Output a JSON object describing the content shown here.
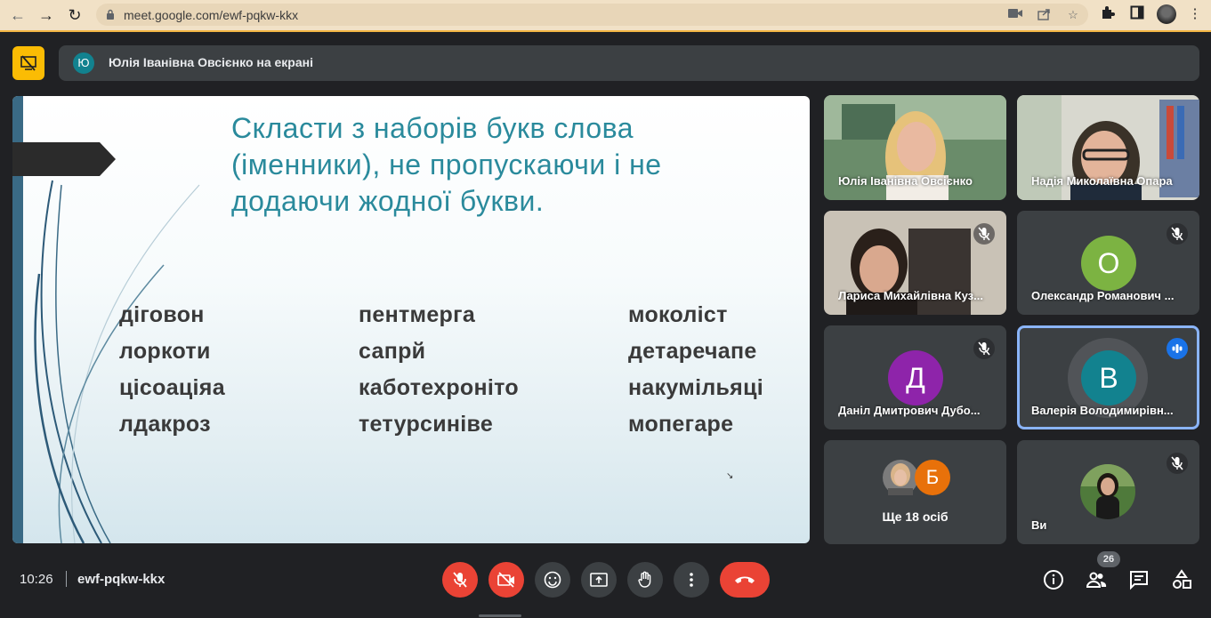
{
  "browser": {
    "url": "meet.google.com/ewf-pqkw-kkx",
    "icons": [
      "back-arrow",
      "forward-arrow",
      "reload",
      "lock",
      "camera",
      "share",
      "star",
      "extensions",
      "sidepanel",
      "profile",
      "more"
    ]
  },
  "presentation": {
    "presenter_initial": "Ю",
    "presenter_text": "Юлія Іванівна Овсієнко на екрані"
  },
  "slide": {
    "title": "Скласти з наборів букв слова (іменники), не пропускаючи і не додаючи жодної букви.",
    "columns": [
      [
        "діговон",
        "лоркоти",
        "цісоаціяа",
        "лдакроз"
      ],
      [
        "пентмерга",
        "сапрй",
        "каботехроніто",
        "тетурсиніве"
      ],
      [
        "моколіст",
        "детаречапе",
        "накумільяці",
        "мопегаре"
      ]
    ]
  },
  "participants": [
    {
      "name": "Юлія Іванівна Овсієнко",
      "type": "video",
      "muted": false
    },
    {
      "name": "Надія Миколаївна Опара",
      "type": "video",
      "muted": false
    },
    {
      "name": "Лариса Михайлівна Куз...",
      "type": "video",
      "muted": true
    },
    {
      "name": "Олександр Романович ...",
      "type": "avatar",
      "initial": "О",
      "color": "#7cb342",
      "muted": true
    },
    {
      "name": "Даніл Дмитрович Дубо...",
      "type": "avatar",
      "initial": "Д",
      "color": "#8e24aa",
      "muted": true
    },
    {
      "name": "Валерія Володимирівн...",
      "type": "avatar",
      "initial": "В",
      "color": "#12828f",
      "speaking": true
    },
    {
      "type": "more",
      "initial": "Б",
      "color": "#e8710a",
      "label": "Ще 18 осіб"
    },
    {
      "name": "Ви",
      "type": "self",
      "muted": true
    }
  ],
  "bottom_bar": {
    "time": "10:26",
    "meeting_code": "ewf-pqkw-kkx",
    "people_count": "26",
    "controls": [
      "mic-off",
      "camera-off",
      "emoji",
      "present",
      "raise-hand",
      "more",
      "end-call"
    ],
    "right_controls": [
      "info",
      "people",
      "chat",
      "activities"
    ]
  },
  "colors": {
    "background": "#202124",
    "tile": "#3c4043",
    "danger": "#ea4335",
    "accent_yellow": "#fbbc04",
    "speaking_border": "#8ab4f8"
  }
}
